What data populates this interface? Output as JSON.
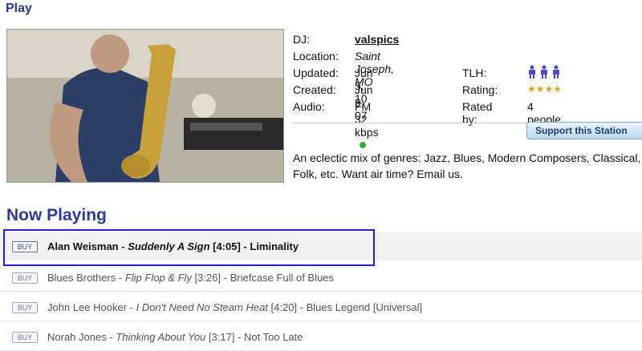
{
  "header": {
    "play_label": "Play"
  },
  "station": {
    "dj_label": "DJ:",
    "dj_value": "valspics",
    "location_label": "Location:",
    "location_value": "Saint Joseph, MO",
    "updated_label": "Updated:",
    "updated_value": "Jun 5, 10",
    "created_label": "Created:",
    "created_value": "Jun 9, 07",
    "audio_label": "Audio:",
    "audio_value": "FM 32 kbps",
    "tlh_label": "TLH:",
    "rating_label": "Rating:",
    "rating_stars": 4,
    "rated_by_label": "Rated by:",
    "rated_by_value": "4 people",
    "support_button": "Support this Station",
    "description": "An eclectic mix of genres: Jazz, Blues, Modern Composers, Classical, Folk, etc. Want air time? Email us."
  },
  "now_playing": {
    "heading": "Now Playing",
    "tracks": [
      {
        "buy": "BUY",
        "artist": "Alan Weisman",
        "title": "Suddenly A Sign",
        "duration": "[4:05]",
        "album": "Liminality",
        "current": true
      },
      {
        "buy": "BUY",
        "artist": "Blues Brothers",
        "title": "Flip Flop & Fly",
        "duration": "[3:26]",
        "album": "Briefcase Full of Blues",
        "current": false
      },
      {
        "buy": "BUY",
        "artist": "John Lee Hooker",
        "title": "I Don't Need No Steam Heat",
        "duration": "[4:20]",
        "album": "Blues Legend [Universal]",
        "current": false
      },
      {
        "buy": "BUY",
        "artist": "Norah Jones",
        "title": "Thinking About You",
        "duration": "[3:17]",
        "album": "Not Too Late",
        "current": false
      }
    ]
  },
  "colors": {
    "accent": "#2b3a9b",
    "audio_dot": "#2fae3b",
    "highlight": "#2020d0",
    "stars": "#d8a21c"
  }
}
